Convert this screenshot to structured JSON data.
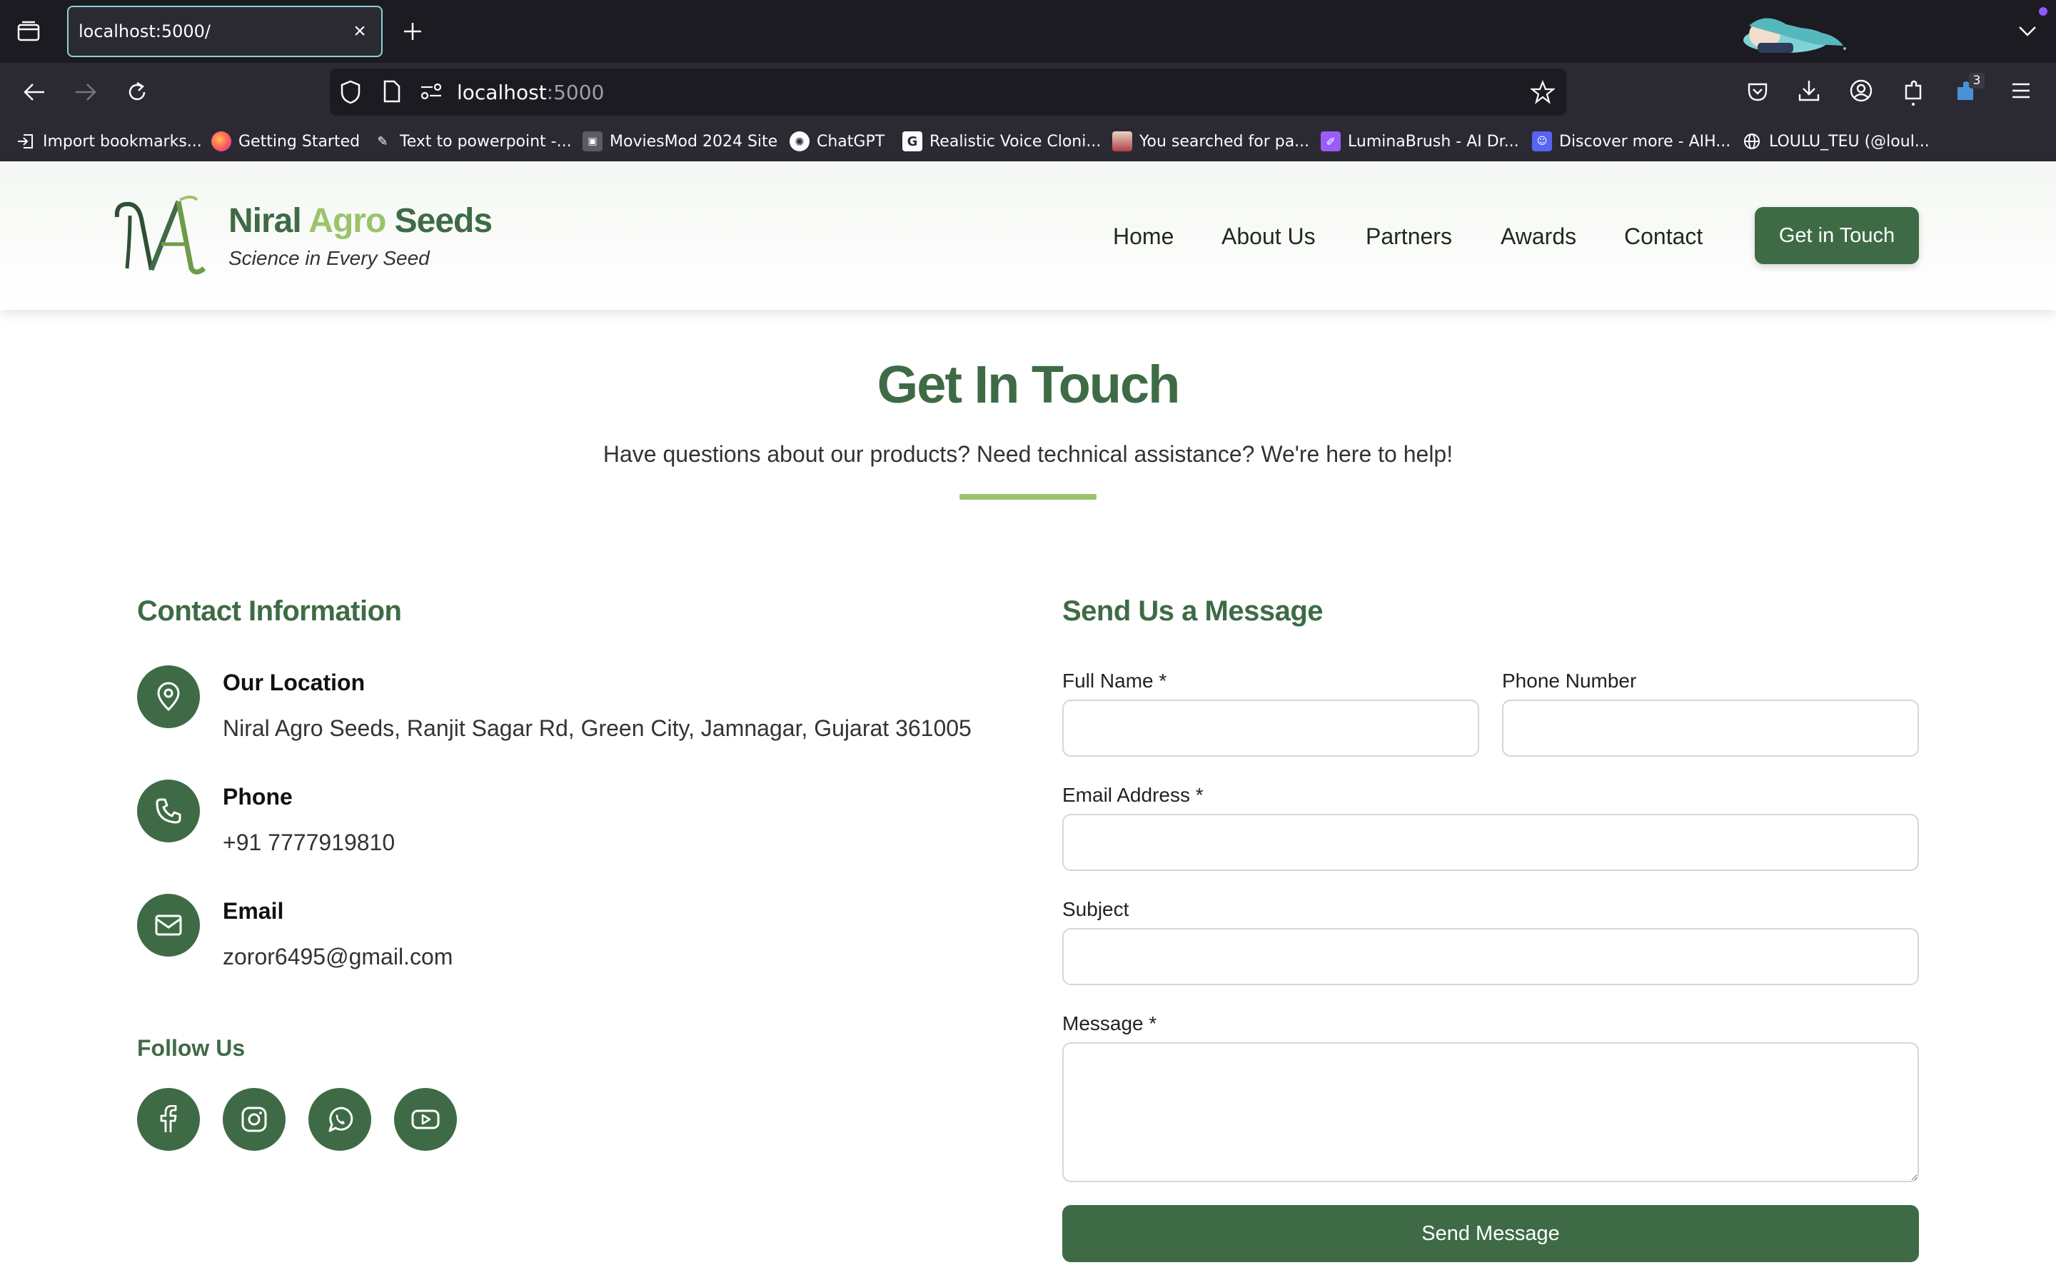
{
  "browser": {
    "tab_title": "localhost:5000/",
    "tab_close": "×",
    "url_host": "localhost",
    "url_port": ":5000",
    "notification_count": "3",
    "accent": "#8fd0d8",
    "bookmarks": [
      {
        "label": "Import bookmarks...",
        "icon": "import-icon"
      },
      {
        "label": "Getting Started",
        "icon": "firefox-icon"
      },
      {
        "label": "Text to powerpoint -...",
        "icon": "ai-icon"
      },
      {
        "label": "MoviesMod 2024 Site",
        "icon": "movie-icon"
      },
      {
        "label": "ChatGPT",
        "icon": "chatgpt-icon"
      },
      {
        "label": "Realistic Voice Cloni...",
        "icon": "g-icon"
      },
      {
        "label": "You searched for pa...",
        "icon": "image-icon"
      },
      {
        "label": "LuminaBrush - AI Dr...",
        "icon": "brush-icon"
      },
      {
        "label": "Discover more - AIH...",
        "icon": "discord-icon"
      },
      {
        "label": "LOULU_TEU (@loul...",
        "icon": "globe-icon"
      }
    ]
  },
  "site": {
    "brand": {
      "word1": "Niral",
      "word2": "Agro",
      "word3": "Seeds",
      "tagline": "Science in Every Seed",
      "logo_letters": "NA"
    },
    "nav": [
      "Home",
      "About Us",
      "Partners",
      "Awards",
      "Contact"
    ],
    "cta": "Get in Touch",
    "primary_color": "#3e6b45",
    "accent_color": "#9cc36b"
  },
  "hero": {
    "title": "Get In Touch",
    "subtitle": "Have questions about our products? Need technical assistance? We're here to help!"
  },
  "contact_info": {
    "title": "Contact Information",
    "items": [
      {
        "icon": "location-pin-icon",
        "label": "Our Location",
        "value": "Niral Agro Seeds, Ranjit Sagar Rd, Green City, Jamnagar, Gujarat 361005"
      },
      {
        "icon": "phone-icon",
        "label": "Phone",
        "value": "+91 7777919810"
      },
      {
        "icon": "mail-icon",
        "label": "Email",
        "value": "zoror6495@gmail.com"
      }
    ],
    "follow_title": "Follow Us",
    "socials": [
      "facebook-icon",
      "instagram-icon",
      "whatsapp-icon",
      "youtube-icon"
    ]
  },
  "form": {
    "title": "Send Us a Message",
    "full_name_label": "Full Name *",
    "phone_label": "Phone Number",
    "email_label": "Email Address *",
    "subject_label": "Subject",
    "message_label": "Message *",
    "full_name_value": "",
    "phone_value": "",
    "email_value": "",
    "subject_value": "",
    "message_value": "",
    "submit": "Send Message"
  }
}
